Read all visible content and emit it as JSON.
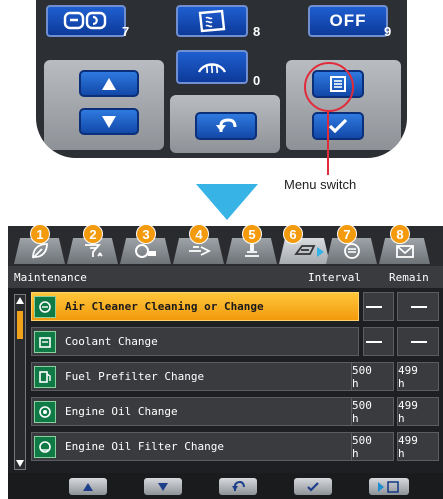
{
  "keypad": {
    "key7_number": "7",
    "key8_number": "8",
    "key9_label": "OFF",
    "key9_number": "9",
    "key0_number": "0",
    "icons": {
      "key7": "mirror-heater-icon",
      "key8": "rear-defroster-icon",
      "key0": "front-defroster-icon",
      "up": "arrow-up-icon",
      "down": "arrow-down-icon",
      "back": "return-icon",
      "menu": "menu-list-icon",
      "confirm": "checkmark-icon"
    }
  },
  "annotation": {
    "label": "Menu switch",
    "color": "#e12b3a"
  },
  "arrow_color": "#37b3e6",
  "screen": {
    "tabs": [
      {
        "number": "1",
        "icon": "leaf-icon"
      },
      {
        "number": "2",
        "icon": "funnel-icon"
      },
      {
        "number": "3",
        "icon": "gauge-icon"
      },
      {
        "number": "4",
        "icon": "hand-pointer-icon"
      },
      {
        "number": "5",
        "icon": "filter-icon"
      },
      {
        "number": "6",
        "icon": "maintenance-icon"
      },
      {
        "number": "7",
        "icon": "list-icon"
      },
      {
        "number": "8",
        "icon": "mail-icon"
      }
    ],
    "active_tab": "6",
    "header": {
      "title": "Maintenance",
      "interval": "Interval",
      "remain": "Remain"
    },
    "rows": [
      {
        "label": "Air Cleaner Cleaning or Change",
        "interval": "—",
        "remain": "—",
        "selected": true
      },
      {
        "label": "Coolant Change",
        "interval": "—",
        "remain": "—",
        "selected": false
      },
      {
        "label": "Fuel Prefilter Change",
        "interval": "500 h",
        "remain": "499 h",
        "selected": false
      },
      {
        "label": "Engine Oil Change",
        "interval": "500 h",
        "remain": "499 h",
        "selected": false
      },
      {
        "label": "Engine Oil Filter Change",
        "interval": "500 h",
        "remain": "499 h",
        "selected": false
      }
    ],
    "footer_icons": [
      "arrow-up-icon",
      "arrow-down-icon",
      "return-icon",
      "checkmark-icon",
      "menu-list-icon"
    ],
    "accent": "#f39a0d"
  }
}
